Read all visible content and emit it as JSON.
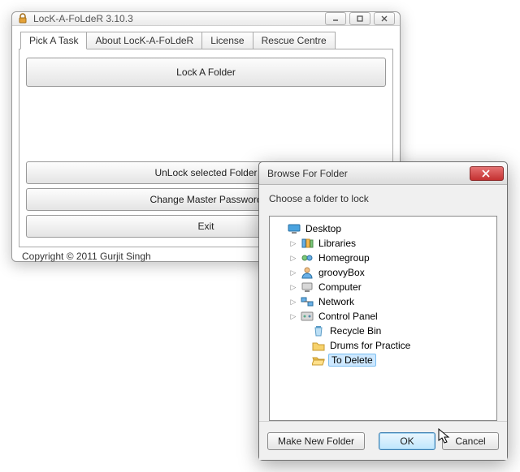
{
  "main": {
    "title": "LocK-A-FoLdeR 3.10.3",
    "tabs": [
      {
        "label": "Pick A Task",
        "active": true
      },
      {
        "label": "About LocK-A-FoLdeR",
        "active": false
      },
      {
        "label": "License",
        "active": false
      },
      {
        "label": "Rescue Centre",
        "active": false
      }
    ],
    "buttons": {
      "lock": "Lock A Folder",
      "unlock": "UnLock selected Folder",
      "change_pw": "Change Master Password",
      "exit": "Exit"
    },
    "copyright": "Copyright © 2011 Gurjit Singh"
  },
  "dialog": {
    "title": "Browse For Folder",
    "label": "Choose a folder to lock",
    "tree": [
      {
        "label": "Desktop",
        "depth": 0,
        "expander": "",
        "icon": "desktop"
      },
      {
        "label": "Libraries",
        "depth": 1,
        "expander": "▷",
        "icon": "libraries"
      },
      {
        "label": "Homegroup",
        "depth": 1,
        "expander": "▷",
        "icon": "homegroup"
      },
      {
        "label": "groovyBox",
        "depth": 1,
        "expander": "▷",
        "icon": "user"
      },
      {
        "label": "Computer",
        "depth": 1,
        "expander": "▷",
        "icon": "computer"
      },
      {
        "label": "Network",
        "depth": 1,
        "expander": "▷",
        "icon": "network"
      },
      {
        "label": "Control Panel",
        "depth": 1,
        "expander": "▷",
        "icon": "controlpanel"
      },
      {
        "label": "Recycle Bin",
        "depth": 2,
        "expander": "",
        "icon": "recycle"
      },
      {
        "label": "Drums for Practice",
        "depth": 2,
        "expander": "",
        "icon": "folder"
      },
      {
        "label": "To Delete",
        "depth": 2,
        "expander": "",
        "icon": "folder-open",
        "selected": true
      }
    ],
    "buttons": {
      "new_folder": "Make New Folder",
      "ok": "OK",
      "cancel": "Cancel"
    }
  }
}
